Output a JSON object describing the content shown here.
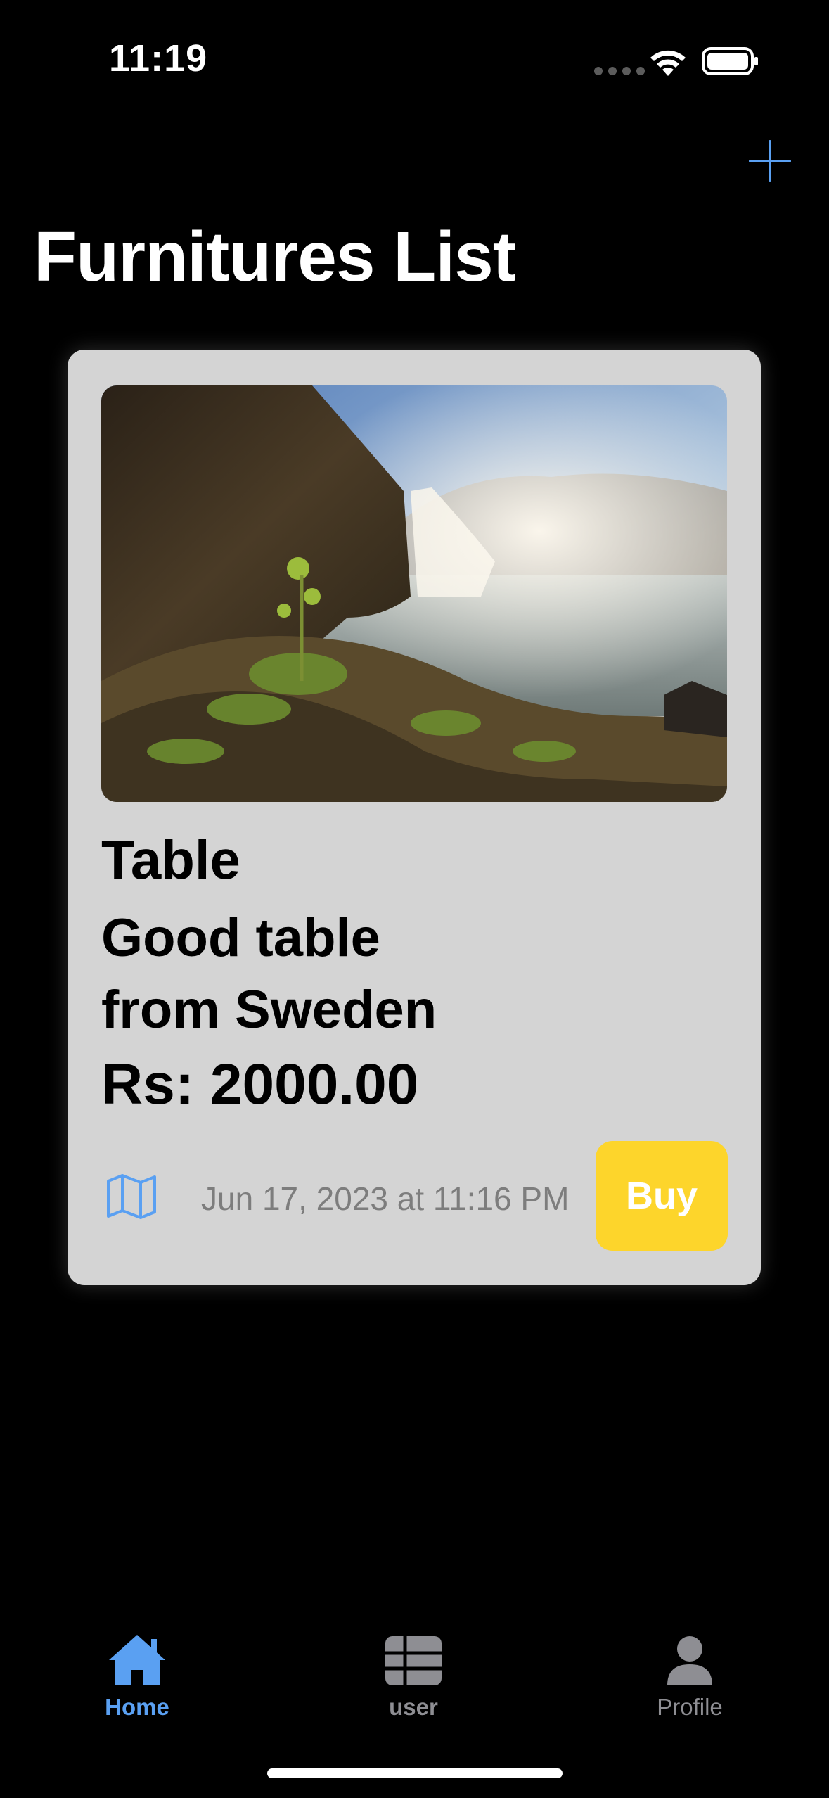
{
  "status_bar": {
    "time": "11:19",
    "icons": [
      "signal-dots-icon",
      "wifi-icon",
      "battery-icon"
    ]
  },
  "nav": {
    "add_icon": "plus-icon",
    "title": "Furnitures List"
  },
  "item": {
    "image_icon": "waterfall-photo",
    "name": "Table",
    "description": "Good table from Sweden",
    "price": "Rs: 2000.00",
    "map_icon": "map-icon",
    "date": "Jun 17, 2023 at 11:16 PM",
    "buy_label": "Buy"
  },
  "tabs": [
    {
      "label": "Home",
      "icon": "house-icon",
      "selected": true
    },
    {
      "label": "user",
      "icon": "grid-icon",
      "selected": false
    },
    {
      "label": "Profile",
      "icon": "person-icon",
      "selected": false
    }
  ],
  "colors": {
    "background": "#000000",
    "card": "#d4d4d4",
    "accent": "#5aa0f2",
    "buy_button": "#fdd52b",
    "tab_inactive": "#8e8e93"
  }
}
